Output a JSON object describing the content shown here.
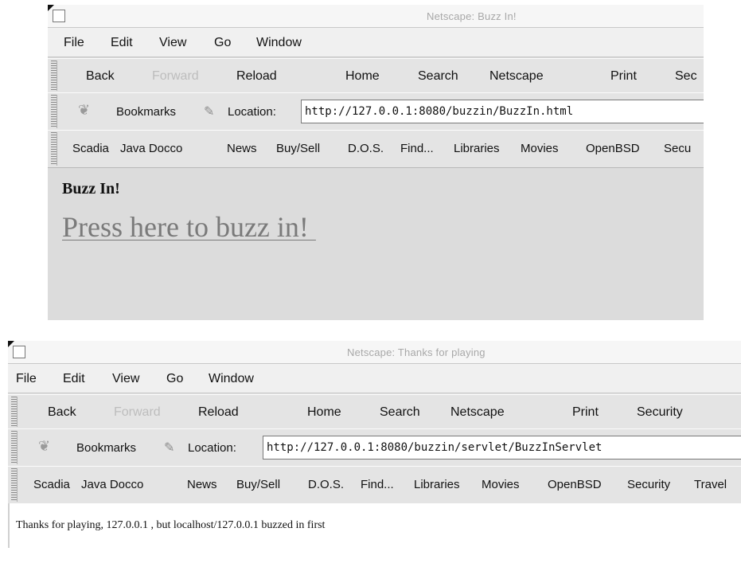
{
  "window1": {
    "title": "Netscape: Buzz In!",
    "menu": [
      "File",
      "Edit",
      "View",
      "Go",
      "Window"
    ],
    "toolbar": {
      "back": "Back",
      "forward": "Forward",
      "reload": "Reload",
      "home": "Home",
      "search": "Search",
      "netscape": "Netscape",
      "print": "Print",
      "security": "Sec"
    },
    "location_bar": {
      "bookmarks": "Bookmarks",
      "location_label": "Location:",
      "url": "http://127.0.0.1:8080/buzzin/BuzzIn.html"
    },
    "personal_toolbar": [
      "Scadia",
      "Java Docco",
      "News",
      "Buy/Sell",
      "D.O.S.",
      "Find...",
      "Libraries",
      "Movies",
      "OpenBSD",
      "Secu"
    ],
    "page": {
      "heading": "Buzz In!",
      "link": "Press here to buzz in! "
    }
  },
  "window2": {
    "title": "Netscape: Thanks for playing",
    "menu": [
      "File",
      "Edit",
      "View",
      "Go",
      "Window"
    ],
    "toolbar": {
      "back": "Back",
      "forward": "Forward",
      "reload": "Reload",
      "home": "Home",
      "search": "Search",
      "netscape": "Netscape",
      "print": "Print",
      "security": "Security"
    },
    "location_bar": {
      "bookmarks": "Bookmarks",
      "location_label": "Location:",
      "url": "http://127.0.0.1:8080/buzzin/servlet/BuzzInServlet"
    },
    "personal_toolbar": [
      "Scadia",
      "Java Docco",
      "News",
      "Buy/Sell",
      "D.O.S.",
      "Find...",
      "Libraries",
      "Movies",
      "OpenBSD",
      "Security",
      "Travel"
    ],
    "page": {
      "message": "Thanks for playing, 127.0.0.1 , but localhost/127.0.0.1 buzzed in first"
    }
  }
}
